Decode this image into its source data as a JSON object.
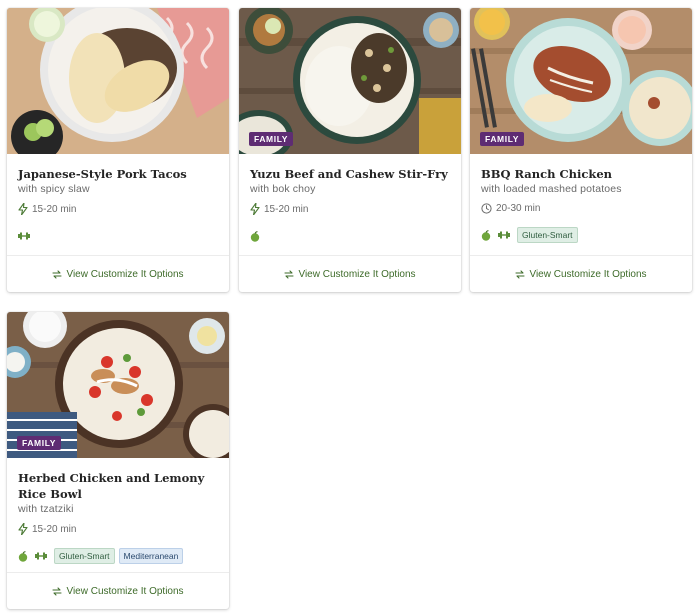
{
  "recipes": [
    {
      "title": "Japanese-Style Pork Tacos",
      "subtitle": "with spicy slaw",
      "time": "15-20 min",
      "time_icon": "lightning-icon",
      "badge": "",
      "icons": [
        "protein-icon"
      ],
      "tags": [],
      "cta": "View Customize It Options"
    },
    {
      "title": "Yuzu Beef and Cashew Stir-Fry",
      "subtitle": "with bok choy",
      "time": "15-20 min",
      "time_icon": "lightning-icon",
      "badge": "FAMILY",
      "icons": [
        "apple-icon"
      ],
      "tags": [],
      "cta": "View Customize It Options"
    },
    {
      "title": "BBQ Ranch Chicken",
      "subtitle": "with loaded mashed potatoes",
      "time": "20-30 min",
      "time_icon": "clock-icon",
      "badge": "FAMILY",
      "icons": [
        "apple-icon",
        "protein-icon"
      ],
      "tags": [
        "Gluten-Smart"
      ],
      "cta": "View Customize It Options"
    },
    {
      "title": "Herbed Chicken and Lemony Rice Bowl",
      "subtitle": "with tzatziki",
      "time": "15-20 min",
      "time_icon": "lightning-icon",
      "badge": "FAMILY",
      "icons": [
        "apple-icon",
        "protein-icon"
      ],
      "tags": [
        "Gluten-Smart",
        "Mediterranean"
      ],
      "cta": "View Customize It Options"
    }
  ],
  "colors": {
    "accent_green": "#3e6b2a",
    "badge_purple": "#5e2c73",
    "tag_green_bg": "#dfeee5",
    "tag_blue_bg": "#dfeaf6"
  }
}
